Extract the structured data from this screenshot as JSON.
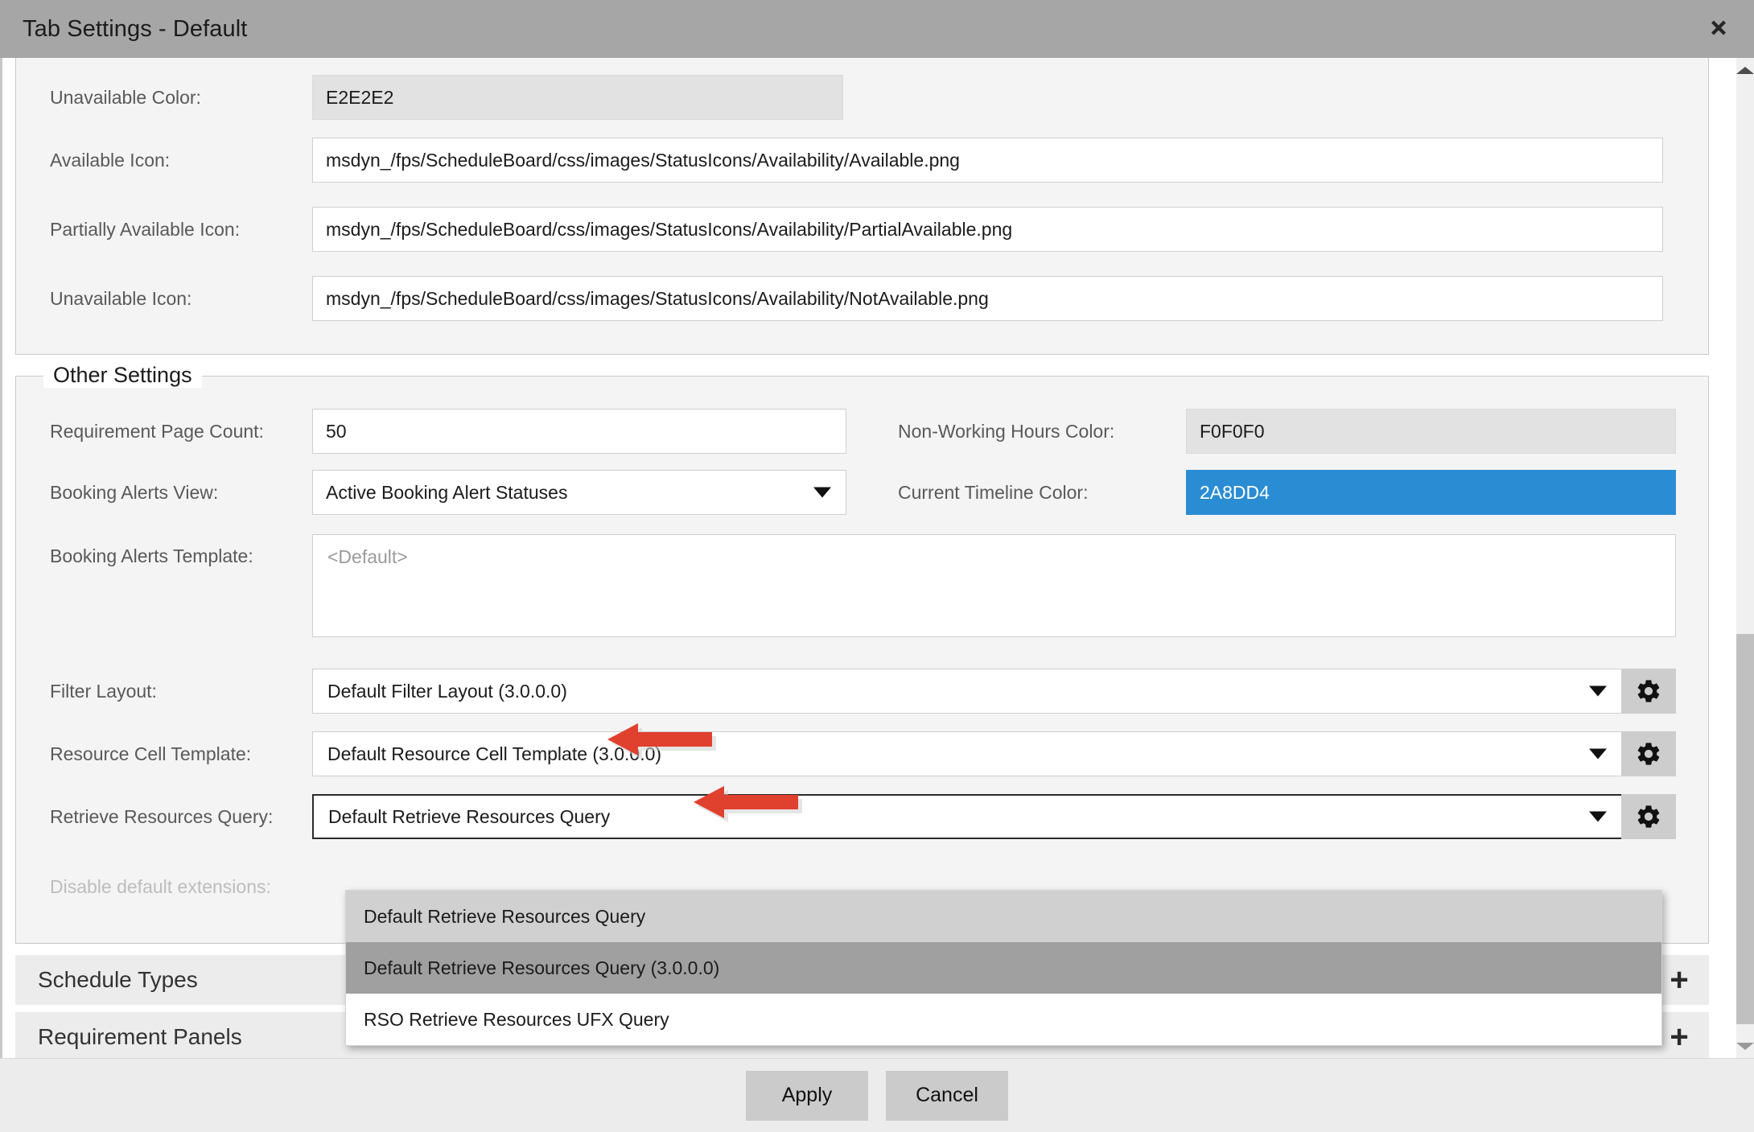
{
  "window": {
    "title": "Tab Settings - Default",
    "close_label": "close-icon"
  },
  "availability_section": {
    "rows": [
      {
        "label": "Unavailable Color:",
        "value": "E2E2E2",
        "type": "color-readonly"
      },
      {
        "label": "Available Icon:",
        "value": "msdyn_/fps/ScheduleBoard/css/images/StatusIcons/Availability/Available.png",
        "type": "text"
      },
      {
        "label": "Partially Available Icon:",
        "value": "msdyn_/fps/ScheduleBoard/css/images/StatusIcons/Availability/PartialAvailable.png",
        "type": "text"
      },
      {
        "label": "Unavailable Icon:",
        "value": "msdyn_/fps/ScheduleBoard/css/images/StatusIcons/Availability/NotAvailable.png",
        "type": "text"
      }
    ]
  },
  "other_settings": {
    "legend": "Other Settings",
    "requirement_page_count": {
      "label": "Requirement Page Count:",
      "value": "50"
    },
    "non_working_hours_color": {
      "label": "Non-Working Hours Color:",
      "value": "F0F0F0",
      "color": "#f0f0f0"
    },
    "booking_alerts_view": {
      "label": "Booking Alerts View:",
      "value": "Active Booking Alert Statuses"
    },
    "current_timeline_color": {
      "label": "Current Timeline Color:",
      "value": "2A8DD4",
      "color": "#2a8dd4"
    },
    "booking_alerts_template": {
      "label": "Booking Alerts Template:",
      "placeholder": "<Default>",
      "value": ""
    },
    "filter_layout": {
      "label": "Filter Layout:",
      "value": "Default Filter Layout (3.0.0.0)",
      "gear": "gear-icon"
    },
    "resource_cell_template": {
      "label": "Resource Cell Template:",
      "value": "Default Resource Cell Template (3.0.0.0)",
      "gear": "gear-icon"
    },
    "retrieve_resources_query": {
      "label": "Retrieve Resources Query:",
      "value": "Default Retrieve Resources Query",
      "gear": "gear-icon"
    },
    "disable_default_extensions": {
      "label": "Disable default extensions:",
      "disabled": true
    }
  },
  "query_dropdown": {
    "open": true,
    "options": [
      {
        "label": "Default Retrieve Resources Query",
        "state": "hover-light"
      },
      {
        "label": "Default Retrieve Resources Query (3.0.0.0)",
        "state": "selected-dark"
      },
      {
        "label": "RSO Retrieve Resources UFX Query",
        "state": "normal"
      }
    ]
  },
  "sections": [
    {
      "title": "Schedule Types",
      "add_label": "+"
    },
    {
      "title": "Requirement Panels",
      "add_label": "+"
    }
  ],
  "footer": {
    "apply_label": "Apply",
    "cancel_label": "Cancel"
  },
  "annotations": {
    "arrow_color": "#e0402e",
    "arrow_filter_layout": "points-to-filter-layout-value",
    "arrow_resource_cell": "points-to-resource-cell-template-value",
    "arrow_dropdown_option": "points-to-default-retrieve-resources-query-3000"
  },
  "scrollbar": {
    "up_arrow": "caret-up-icon",
    "down_arrow": "caret-down-icon"
  }
}
